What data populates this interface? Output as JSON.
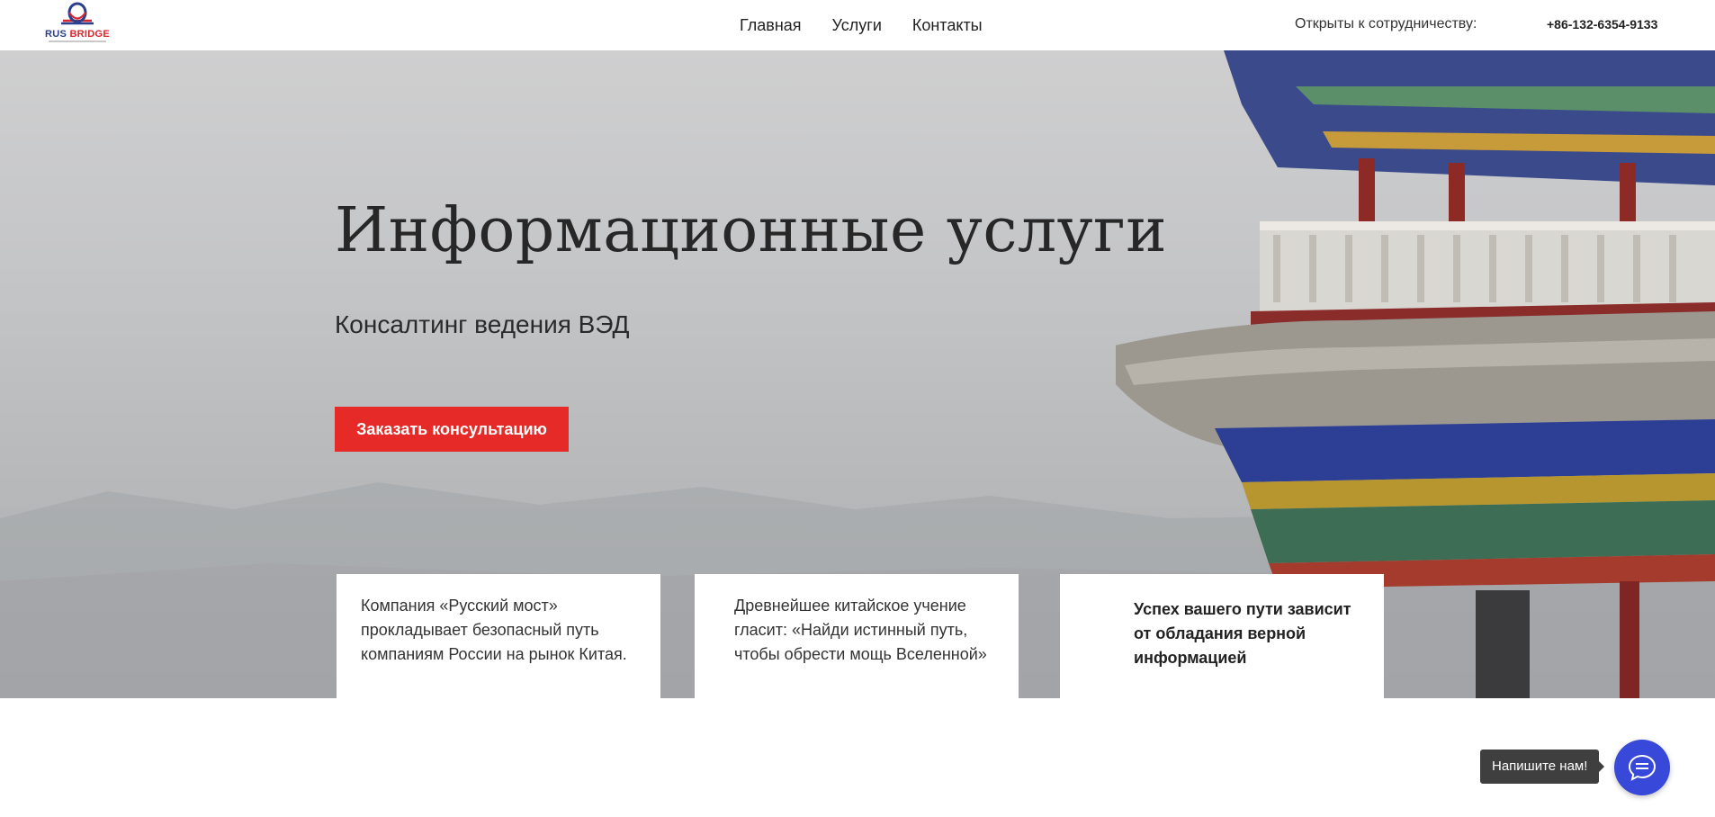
{
  "header": {
    "logo": {
      "text_main": "RUS ",
      "text_accent": "BRIDGE",
      "icon": "rus-bridge-logo-icon"
    },
    "nav": [
      {
        "label": "Главная"
      },
      {
        "label": "Услуги"
      },
      {
        "label": "Контакты"
      }
    ],
    "coop_text": "Открыты к сотрудничеству:",
    "phone": "+86-132-6354-9133"
  },
  "hero": {
    "title": "Информационные услуги",
    "subtitle": "Консалтинг ведения ВЭД",
    "cta_label": "Заказать консультацию",
    "background_image": "pagoda-photo",
    "cards": [
      {
        "text": "Компания «Русский мост» прокладывает безопасный путь компаниям России на рынок Китая."
      },
      {
        "text": "Древнейшее китайское учение гласит: «Найди истинный путь, чтобы обрести мощь Вселенной»"
      },
      {
        "text": "Успех вашего пути зависит от обладания верной информацией"
      }
    ]
  },
  "chat": {
    "label": "Напишите нам!",
    "icon": "chat-bubble-icon"
  },
  "colors": {
    "accent_red": "#e52a27",
    "chat_blue": "#3848d8",
    "logo_blue": "#2b3f8e"
  }
}
